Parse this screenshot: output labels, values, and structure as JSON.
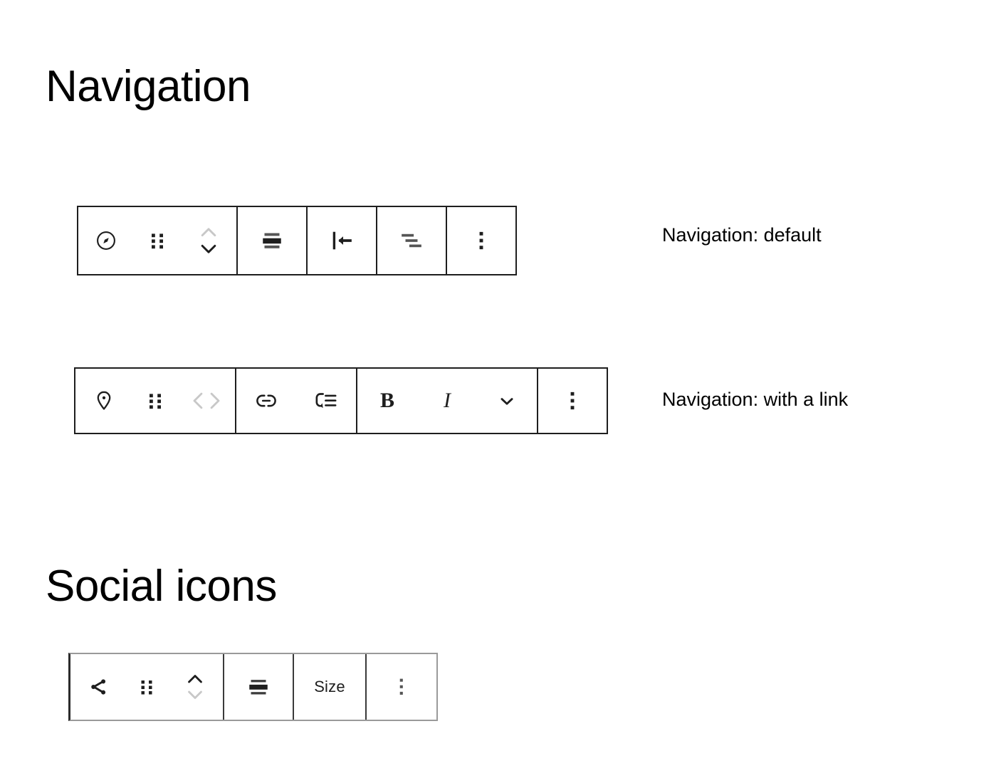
{
  "page": {
    "sections": [
      {
        "heading": "Navigation"
      },
      {
        "heading": "Social icons"
      }
    ]
  },
  "captions": {
    "nav_default": "Navigation: default",
    "nav_with_link": "Navigation: with a link"
  },
  "colors": {
    "text": "#1e1e1e",
    "border_dark": "#1e1e1e",
    "border_light": "#9a9a9a",
    "disabled": "#c8c8c8",
    "background": "#ffffff"
  },
  "toolbars": {
    "nav_default": {
      "name": "Navigation: default",
      "groups": [
        {
          "name": "block-controls",
          "buttons": [
            {
              "icon": "compass-icon",
              "label": "Navigation",
              "state": "enabled"
            },
            {
              "icon": "drag-handle-icon",
              "label": "Drag",
              "state": "enabled"
            },
            {
              "icon": "move-up-down-icon",
              "label": "Move up or down",
              "state": "partially-disabled"
            }
          ]
        },
        {
          "name": "align-controls",
          "buttons": [
            {
              "icon": "align-center-icon",
              "label": "Align",
              "state": "enabled"
            }
          ]
        },
        {
          "name": "justify-controls",
          "buttons": [
            {
              "icon": "justify-left-icon",
              "label": "Justify items left",
              "state": "enabled"
            }
          ]
        },
        {
          "name": "orientation-controls",
          "buttons": [
            {
              "icon": "text-stagger-icon",
              "label": "Change items justification",
              "state": "enabled"
            }
          ]
        },
        {
          "name": "more-controls",
          "buttons": [
            {
              "icon": "more-options-icon",
              "label": "Options",
              "state": "enabled"
            }
          ]
        }
      ]
    },
    "nav_with_link": {
      "name": "Navigation: with a link",
      "groups": [
        {
          "name": "block-controls",
          "buttons": [
            {
              "icon": "map-pin-icon",
              "label": "Page link",
              "state": "enabled"
            },
            {
              "icon": "drag-handle-icon",
              "label": "Drag",
              "state": "enabled"
            },
            {
              "icon": "move-left-right-icon",
              "label": "Move left or right",
              "state": "disabled"
            }
          ]
        },
        {
          "name": "link-controls",
          "buttons": [
            {
              "icon": "link-icon",
              "label": "Link",
              "state": "enabled"
            },
            {
              "icon": "add-submenu-icon",
              "label": "Add submenu",
              "state": "enabled"
            }
          ]
        },
        {
          "name": "format-controls",
          "buttons": [
            {
              "icon": "bold-icon",
              "label": "B",
              "state": "enabled"
            },
            {
              "icon": "italic-icon",
              "label": "I",
              "state": "enabled"
            },
            {
              "icon": "chevron-down-icon",
              "label": "More rich text controls",
              "state": "enabled"
            }
          ]
        },
        {
          "name": "more-controls",
          "buttons": [
            {
              "icon": "more-options-icon",
              "label": "Options",
              "state": "enabled"
            }
          ]
        }
      ]
    },
    "social": {
      "name": "Social icons",
      "groups": [
        {
          "name": "block-controls",
          "buttons": [
            {
              "icon": "share-icon",
              "label": "Social Icons",
              "state": "enabled"
            },
            {
              "icon": "drag-handle-icon",
              "label": "Drag",
              "state": "enabled"
            },
            {
              "icon": "move-up-down-icon",
              "label": "Move up or down",
              "state": "partially-disabled"
            }
          ]
        },
        {
          "name": "align-controls",
          "buttons": [
            {
              "icon": "align-center-icon",
              "label": "Align",
              "state": "enabled"
            }
          ]
        },
        {
          "name": "size-controls",
          "buttons": [
            {
              "icon": "size-text",
              "label": "Size",
              "state": "enabled"
            }
          ]
        },
        {
          "name": "more-controls",
          "buttons": [
            {
              "icon": "more-options-icon",
              "label": "Options",
              "state": "enabled"
            }
          ]
        }
      ]
    }
  }
}
